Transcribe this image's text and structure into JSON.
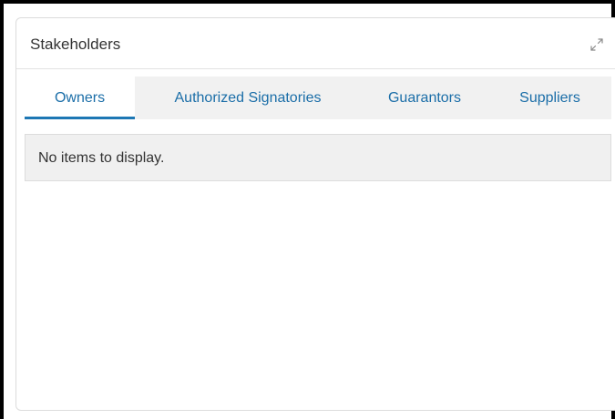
{
  "panel": {
    "title": "Stakeholders",
    "expand_icon": "expand-icon"
  },
  "tabs": [
    {
      "label": "Owners",
      "active": true
    },
    {
      "label": "Authorized Signatories",
      "active": false
    },
    {
      "label": "Guarantors",
      "active": false
    },
    {
      "label": "Suppliers",
      "active": false
    }
  ],
  "content": {
    "empty_message": "No items to display."
  },
  "colors": {
    "tab_text": "#1b6ea8",
    "active_underline": "#1d77b4",
    "tab_bar_bg": "#f1f1f1",
    "empty_row_bg": "#f0f0f0"
  }
}
